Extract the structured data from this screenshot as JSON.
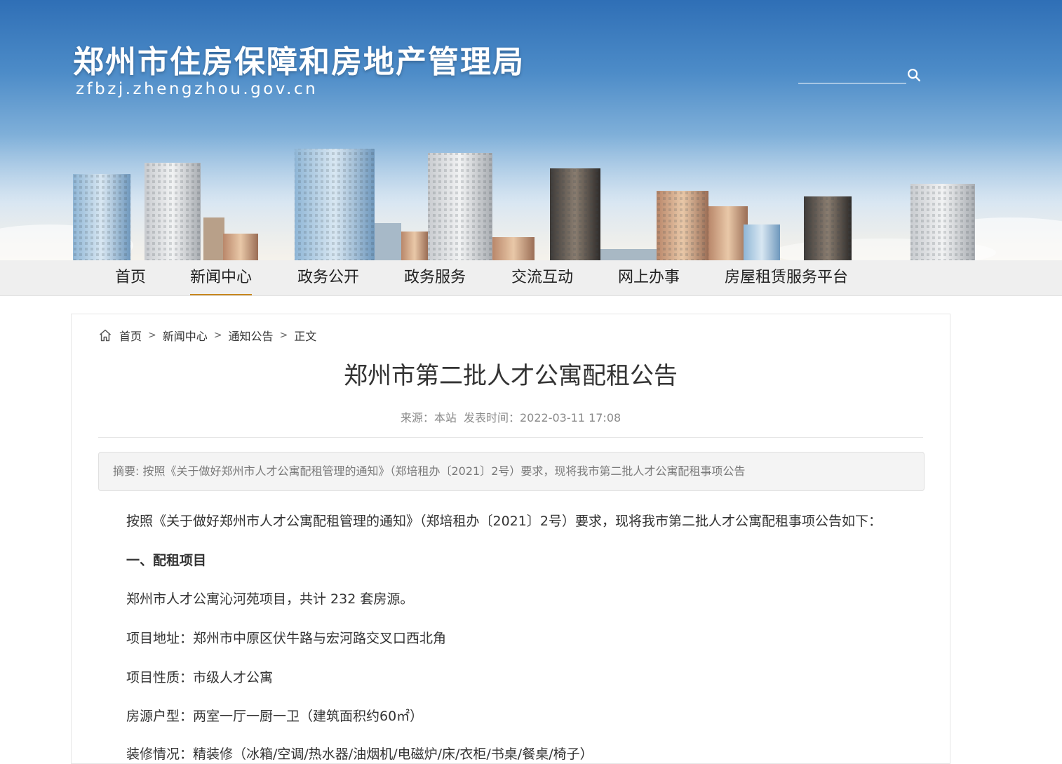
{
  "header": {
    "site_title": "郑州市住房保障和房地产管理局",
    "site_domain": "zfbzj.zhengzhou.gov.cn",
    "search_placeholder": "",
    "search_icon": "search-icon"
  },
  "nav": {
    "items": [
      {
        "label": "首页"
      },
      {
        "label": "新闻中心"
      },
      {
        "label": "政务公开"
      },
      {
        "label": "政务服务"
      },
      {
        "label": "交流互动"
      },
      {
        "label": "网上办事"
      },
      {
        "label": "房屋租赁服务平台"
      }
    ],
    "active_index": 1,
    "active_underline_color": "#c8871f"
  },
  "breadcrumb": {
    "home_icon": "home-icon",
    "items": [
      "首页",
      "新闻中心",
      "通知公告"
    ],
    "current": "正文"
  },
  "article": {
    "title": "郑州市第二批人才公寓配租公告",
    "source": "来源：本站",
    "published": "发表时间：2022-03-11 17:08",
    "summary": "摘要: 按照《关于做好郑州市人才公寓配租管理的通知》（郑培租办〔2021〕2号）要求，现将我市第二批人才公寓配租事项公告",
    "paragraphs": [
      "按照《关于做好郑州市人才公寓配租管理的通知》（郑培租办〔2021〕2号）要求，现将我市第二批人才公寓配租事项公告如下：",
      "一、配租项目",
      "郑州市人才公寓沁河苑项目，共计 232 套房源。",
      "项目地址：郑州市中原区伏牛路与宏河路交叉口西北角",
      "项目性质：市级人才公寓",
      "房源户型：两室一厅一厨一卫（建筑面积约60㎡）",
      "装修情况：精装修（冰箱/空调/热水器/油烟机/电磁炉/床/衣柜/书桌/餐桌/椅子）"
    ]
  }
}
